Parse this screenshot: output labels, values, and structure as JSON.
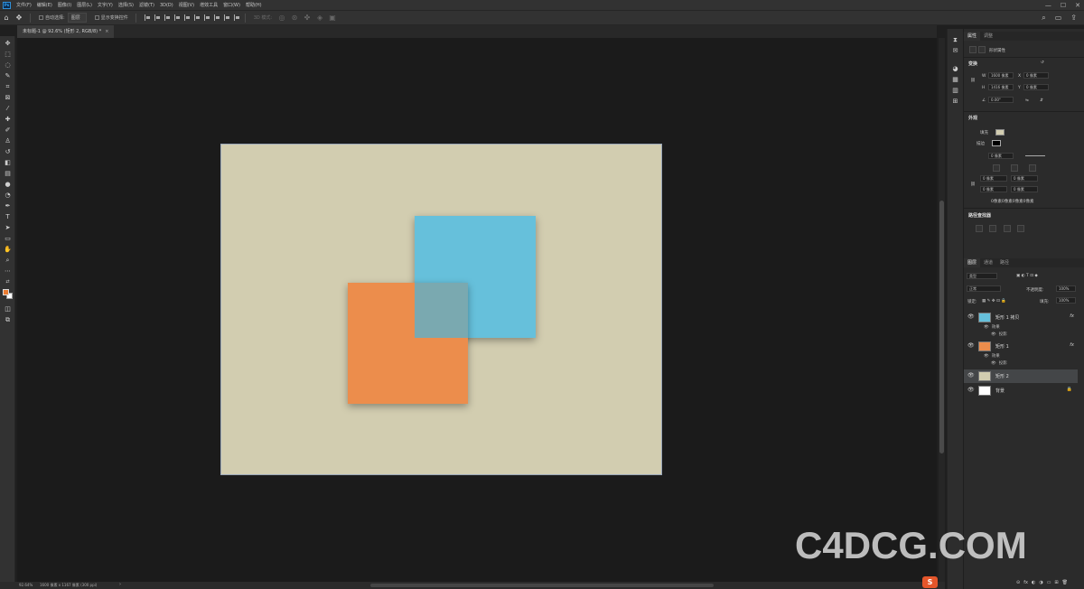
{
  "app": {
    "logo": "Ps"
  },
  "menubar": {
    "items": [
      "文件(F)",
      "编辑(E)",
      "图像(I)",
      "图层(L)",
      "文字(Y)",
      "选择(S)",
      "滤镜(T)",
      "3D(D)",
      "视图(V)",
      "增效工具",
      "窗口(W)",
      "帮助(H)"
    ],
    "controls": {
      "minimize": "—",
      "maximize": "☐",
      "close": "✕"
    }
  },
  "optionsbar": {
    "auto_select_label": "自动选择:",
    "auto_select_value": "图层",
    "show_transform_label": "显示变换控件",
    "mode_3d_label": "3D 模式:"
  },
  "document": {
    "tab_title": "未标题-1 @ 92.6% (矩形 2, RGB/8) *",
    "close_glyph": "×"
  },
  "statusbar": {
    "zoom": "92.64%",
    "info": "1600 像素 x 1167 像素 (300 ppi)",
    "arrow": "›"
  },
  "canvas": {
    "artboard_color": "#d2cdb0",
    "blue_color": "#66c0db",
    "orange_color": "#ec8d4c",
    "overlap_color": "#7aa9b0"
  },
  "properties": {
    "tabs": [
      "属性",
      "调整"
    ],
    "kind": "形状属性",
    "transform_title": "变换",
    "w_label": "W",
    "w_value": "1600 像素",
    "x_label": "X",
    "x_value": "0 像素",
    "h_label": "H",
    "h_value": "1416 像素",
    "y_label": "Y",
    "y_value": "0 像素",
    "angle_value": "0.00°",
    "appearance_title": "外观",
    "fill_label": "填充",
    "stroke_label": "描边",
    "stroke_width": "0 像素",
    "radius_values": [
      "0 像素",
      "0 像素",
      "0 像素",
      "0 像素"
    ],
    "radius_summary": "0像素0像素0像素0像素",
    "pathfinder_title": "路径查找器"
  },
  "layers": {
    "tabs": [
      "图层",
      "通道",
      "路径"
    ],
    "filter_label": "类型",
    "blend_mode": "正常",
    "opacity_label": "不透明度:",
    "opacity_value": "100%",
    "lock_label": "锁定:",
    "fill_label": "填充:",
    "fill_value": "100%",
    "items": [
      {
        "name": "矩形 1 拷贝",
        "fx": "fx",
        "effects_label": "效果",
        "effect": "投影",
        "thumb": "#66c0db"
      },
      {
        "name": "矩形 1",
        "fx": "fx",
        "effects_label": "效果",
        "effect": "投影",
        "thumb": "#ec8d4c"
      },
      {
        "name": "矩形 2",
        "thumb": "#d2cdb0"
      },
      {
        "name": "背景",
        "lock": "🔒",
        "thumb": "#ffffff"
      }
    ],
    "footer_icons": [
      "⊝",
      "fx",
      "◐",
      "◑",
      "▭",
      "⊞",
      "🗑"
    ]
  },
  "watermark": {
    "text": "C4DCG.COM"
  },
  "taskbar": {
    "ime_glyph": "S"
  }
}
